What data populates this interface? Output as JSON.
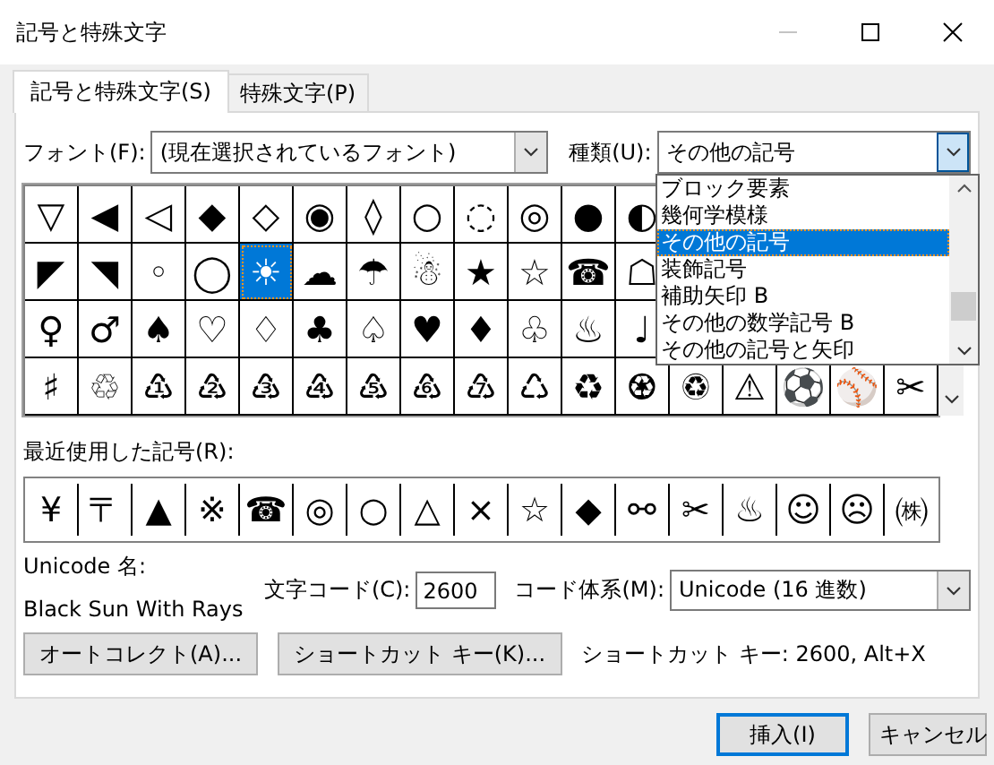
{
  "window": {
    "title": "記号と特殊文字"
  },
  "tabs": [
    {
      "label": "記号と特殊文字(S)",
      "selected": true
    },
    {
      "label": "特殊文字(P)",
      "selected": false
    }
  ],
  "font": {
    "label": "フォント(F):",
    "value": "(現在選択されているフォント)"
  },
  "subset": {
    "label": "種類(U):",
    "value": "その他の記号",
    "expanded": true,
    "options": [
      {
        "label": "ブロック要素",
        "selected": false
      },
      {
        "label": "幾何学模様",
        "selected": false
      },
      {
        "label": "その他の記号",
        "selected": true
      },
      {
        "label": "装飾記号",
        "selected": false
      },
      {
        "label": "補助矢印 B",
        "selected": false
      },
      {
        "label": "その他の数学記号 B",
        "selected": false
      },
      {
        "label": "その他の記号と矢印",
        "selected": false
      }
    ]
  },
  "symbols": [
    [
      {
        "char": "▽",
        "selected": false
      },
      {
        "char": "◀",
        "selected": false
      },
      {
        "char": "◁",
        "selected": false
      },
      {
        "char": "◆",
        "selected": false
      },
      {
        "char": "◇",
        "selected": false
      },
      {
        "char": "◉",
        "selected": false
      },
      {
        "char": "◊",
        "selected": false
      },
      {
        "char": "○",
        "selected": false
      },
      {
        "char": "◌",
        "selected": false
      },
      {
        "char": "◎",
        "selected": false
      },
      {
        "char": "●",
        "selected": false
      },
      {
        "char": "◐",
        "selected": false
      }
    ],
    [
      {
        "char": "◤",
        "selected": false
      },
      {
        "char": "◥",
        "selected": false
      },
      {
        "char": "◦",
        "selected": false
      },
      {
        "char": "◯",
        "selected": false
      },
      {
        "char": "☀",
        "selected": true
      },
      {
        "char": "☁",
        "selected": false
      },
      {
        "char": "☂",
        "selected": false
      },
      {
        "char": "☃",
        "selected": false
      },
      {
        "char": "★",
        "selected": false
      },
      {
        "char": "☆",
        "selected": false
      },
      {
        "char": "☎",
        "selected": false
      },
      {
        "char": "☖",
        "selected": false
      }
    ],
    [
      {
        "char": "♀",
        "selected": false
      },
      {
        "char": "♂",
        "selected": false
      },
      {
        "char": "♠",
        "selected": false
      },
      {
        "char": "♡",
        "selected": false
      },
      {
        "char": "♢",
        "selected": false
      },
      {
        "char": "♣",
        "selected": false
      },
      {
        "char": "♤",
        "selected": false
      },
      {
        "char": "♥",
        "selected": false
      },
      {
        "char": "♦",
        "selected": false
      },
      {
        "char": "♧",
        "selected": false
      },
      {
        "char": "♨",
        "selected": false
      },
      {
        "char": "♩",
        "selected": false
      }
    ],
    [
      {
        "char": "♯",
        "selected": false
      },
      {
        "char": "♲",
        "selected": false
      },
      {
        "char": "♳",
        "selected": false
      },
      {
        "char": "♴",
        "selected": false
      },
      {
        "char": "♵",
        "selected": false
      },
      {
        "char": "♶",
        "selected": false
      },
      {
        "char": "♷",
        "selected": false
      },
      {
        "char": "♸",
        "selected": false
      },
      {
        "char": "♹",
        "selected": false
      },
      {
        "char": "♺",
        "selected": false
      },
      {
        "char": "♻",
        "selected": false
      },
      {
        "char": "♼",
        "selected": false
      },
      {
        "char": "♽",
        "selected": false
      },
      {
        "char": "⚠",
        "selected": false
      },
      {
        "char": "⚽",
        "selected": false
      },
      {
        "char": "⚾",
        "selected": false
      },
      {
        "char": "✂",
        "selected": false
      }
    ]
  ],
  "recent": {
    "label": "最近使用した記号(R):",
    "symbols": [
      "¥",
      "〒",
      "▲",
      "※",
      "☎",
      "◎",
      "○",
      "△",
      "×",
      "☆",
      "◆",
      "⚯",
      "✂",
      "♨",
      "☺",
      "☹",
      "㈱"
    ]
  },
  "unicode_name": {
    "label": "Unicode 名:",
    "value": "Black Sun With Rays"
  },
  "char_code": {
    "label": "文字コード(C):",
    "value": "2600"
  },
  "code_system": {
    "label": "コード体系(M):",
    "value": "Unicode (16 進数)"
  },
  "action_buttons": [
    "オートコレクト(A)...",
    "ショートカット キー(K)..."
  ],
  "shortcut_text": "ショートカット キー: 2600, Alt+X",
  "footer_buttons": [
    {
      "label": "挿入(I)",
      "default": true
    },
    {
      "label": "キャンセル",
      "default": false
    }
  ]
}
